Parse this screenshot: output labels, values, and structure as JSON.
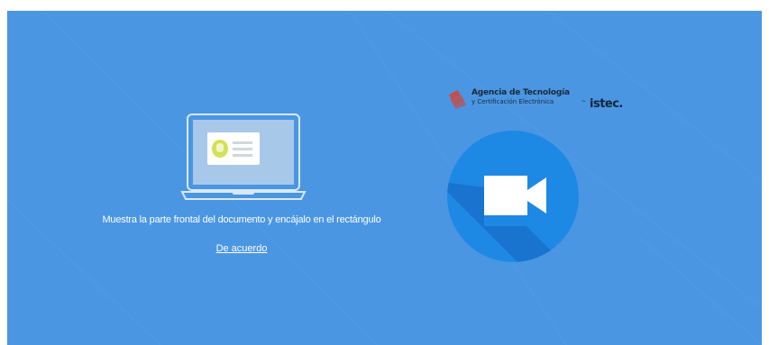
{
  "instructions": {
    "text": "Muestra la parte frontal del documento y encájalo en el rectángulo",
    "confirm_link": "De acuerdo"
  },
  "logo": {
    "line1": "Agencia de Tecnología",
    "line2": "y Certificación Electrónica",
    "brand": "istec.",
    "brand_prefix": "~"
  },
  "icons": {
    "laptop": "laptop-id-card-icon",
    "camera": "video-camera-icon",
    "logo_mark": "accv-logo-mark-icon"
  },
  "colors": {
    "background": "#4a96e3",
    "camera_circle": "#1e88e5",
    "id_card_photo": "#d4e157"
  }
}
